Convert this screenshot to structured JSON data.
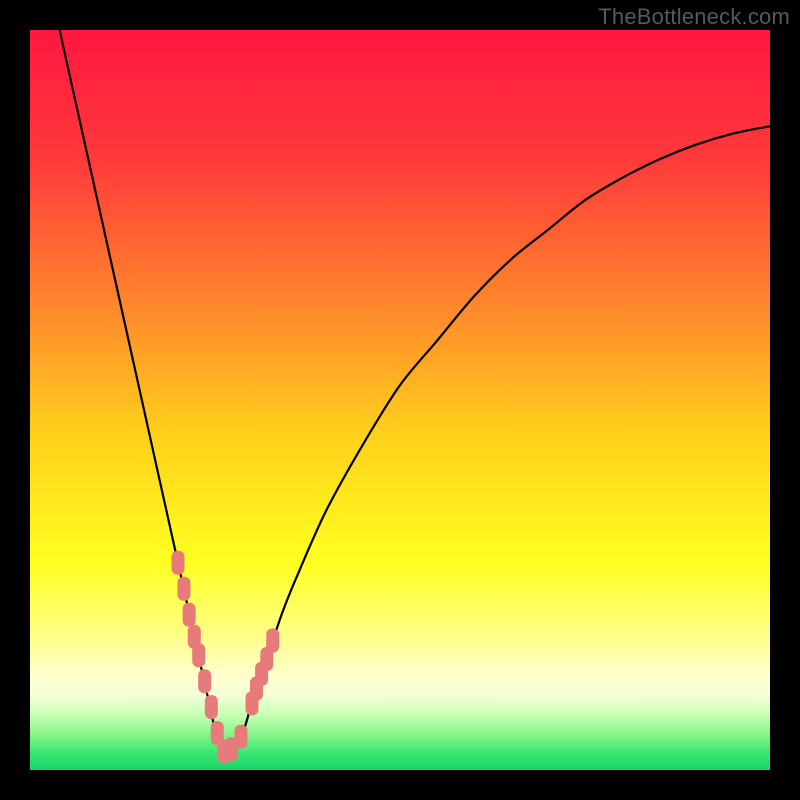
{
  "watermark": "TheBottleneck.com",
  "colors": {
    "frame": "#000000",
    "gradient_stops": [
      {
        "offset": 0.0,
        "color": "#ff173f"
      },
      {
        "offset": 0.18,
        "color": "#ff3b3a"
      },
      {
        "offset": 0.38,
        "color": "#ff8a2a"
      },
      {
        "offset": 0.55,
        "color": "#ffd21a"
      },
      {
        "offset": 0.72,
        "color": "#ffff20"
      },
      {
        "offset": 0.82,
        "color": "#ffff8a"
      },
      {
        "offset": 0.875,
        "color": "#ffffd0"
      },
      {
        "offset": 0.9,
        "color": "#f2ffd6"
      },
      {
        "offset": 0.925,
        "color": "#c8ffb4"
      },
      {
        "offset": 0.95,
        "color": "#8cf58c"
      },
      {
        "offset": 0.975,
        "color": "#3fe873"
      },
      {
        "offset": 1.0,
        "color": "#16d46b"
      }
    ],
    "curve": "#000000",
    "marker_fill": "#e77a7a",
    "marker_stroke": "#d46464"
  },
  "chart_data": {
    "type": "line",
    "title": "",
    "xlabel": "",
    "ylabel": "",
    "xlim": [
      0,
      100
    ],
    "ylim": [
      0,
      100
    ],
    "optimum_x": 26,
    "series": [
      {
        "name": "bottleneck-curve",
        "x": [
          4,
          6,
          8,
          10,
          12,
          14,
          16,
          18,
          20,
          22,
          24,
          26,
          28,
          30,
          32,
          34,
          36,
          40,
          45,
          50,
          55,
          60,
          65,
          70,
          75,
          80,
          85,
          90,
          95,
          100
        ],
        "y": [
          100,
          91,
          82,
          73,
          64,
          55,
          46,
          37,
          28,
          19,
          10,
          2,
          3,
          9,
          15,
          21,
          26,
          35,
          44,
          52,
          58,
          64,
          69,
          73,
          77,
          80,
          82.5,
          84.5,
          86,
          87
        ]
      }
    ],
    "markers": {
      "name": "sampled-points",
      "x": [
        20.0,
        20.8,
        21.5,
        22.2,
        22.8,
        23.6,
        24.5,
        25.3,
        26.2,
        27.2,
        28.5,
        30.0,
        30.6,
        31.3,
        32.0,
        32.8
      ],
      "y": [
        28.0,
        24.5,
        21.0,
        18.0,
        15.5,
        12.0,
        8.5,
        5.0,
        2.5,
        2.8,
        4.5,
        9.0,
        11.0,
        13.0,
        15.0,
        17.5
      ]
    }
  }
}
